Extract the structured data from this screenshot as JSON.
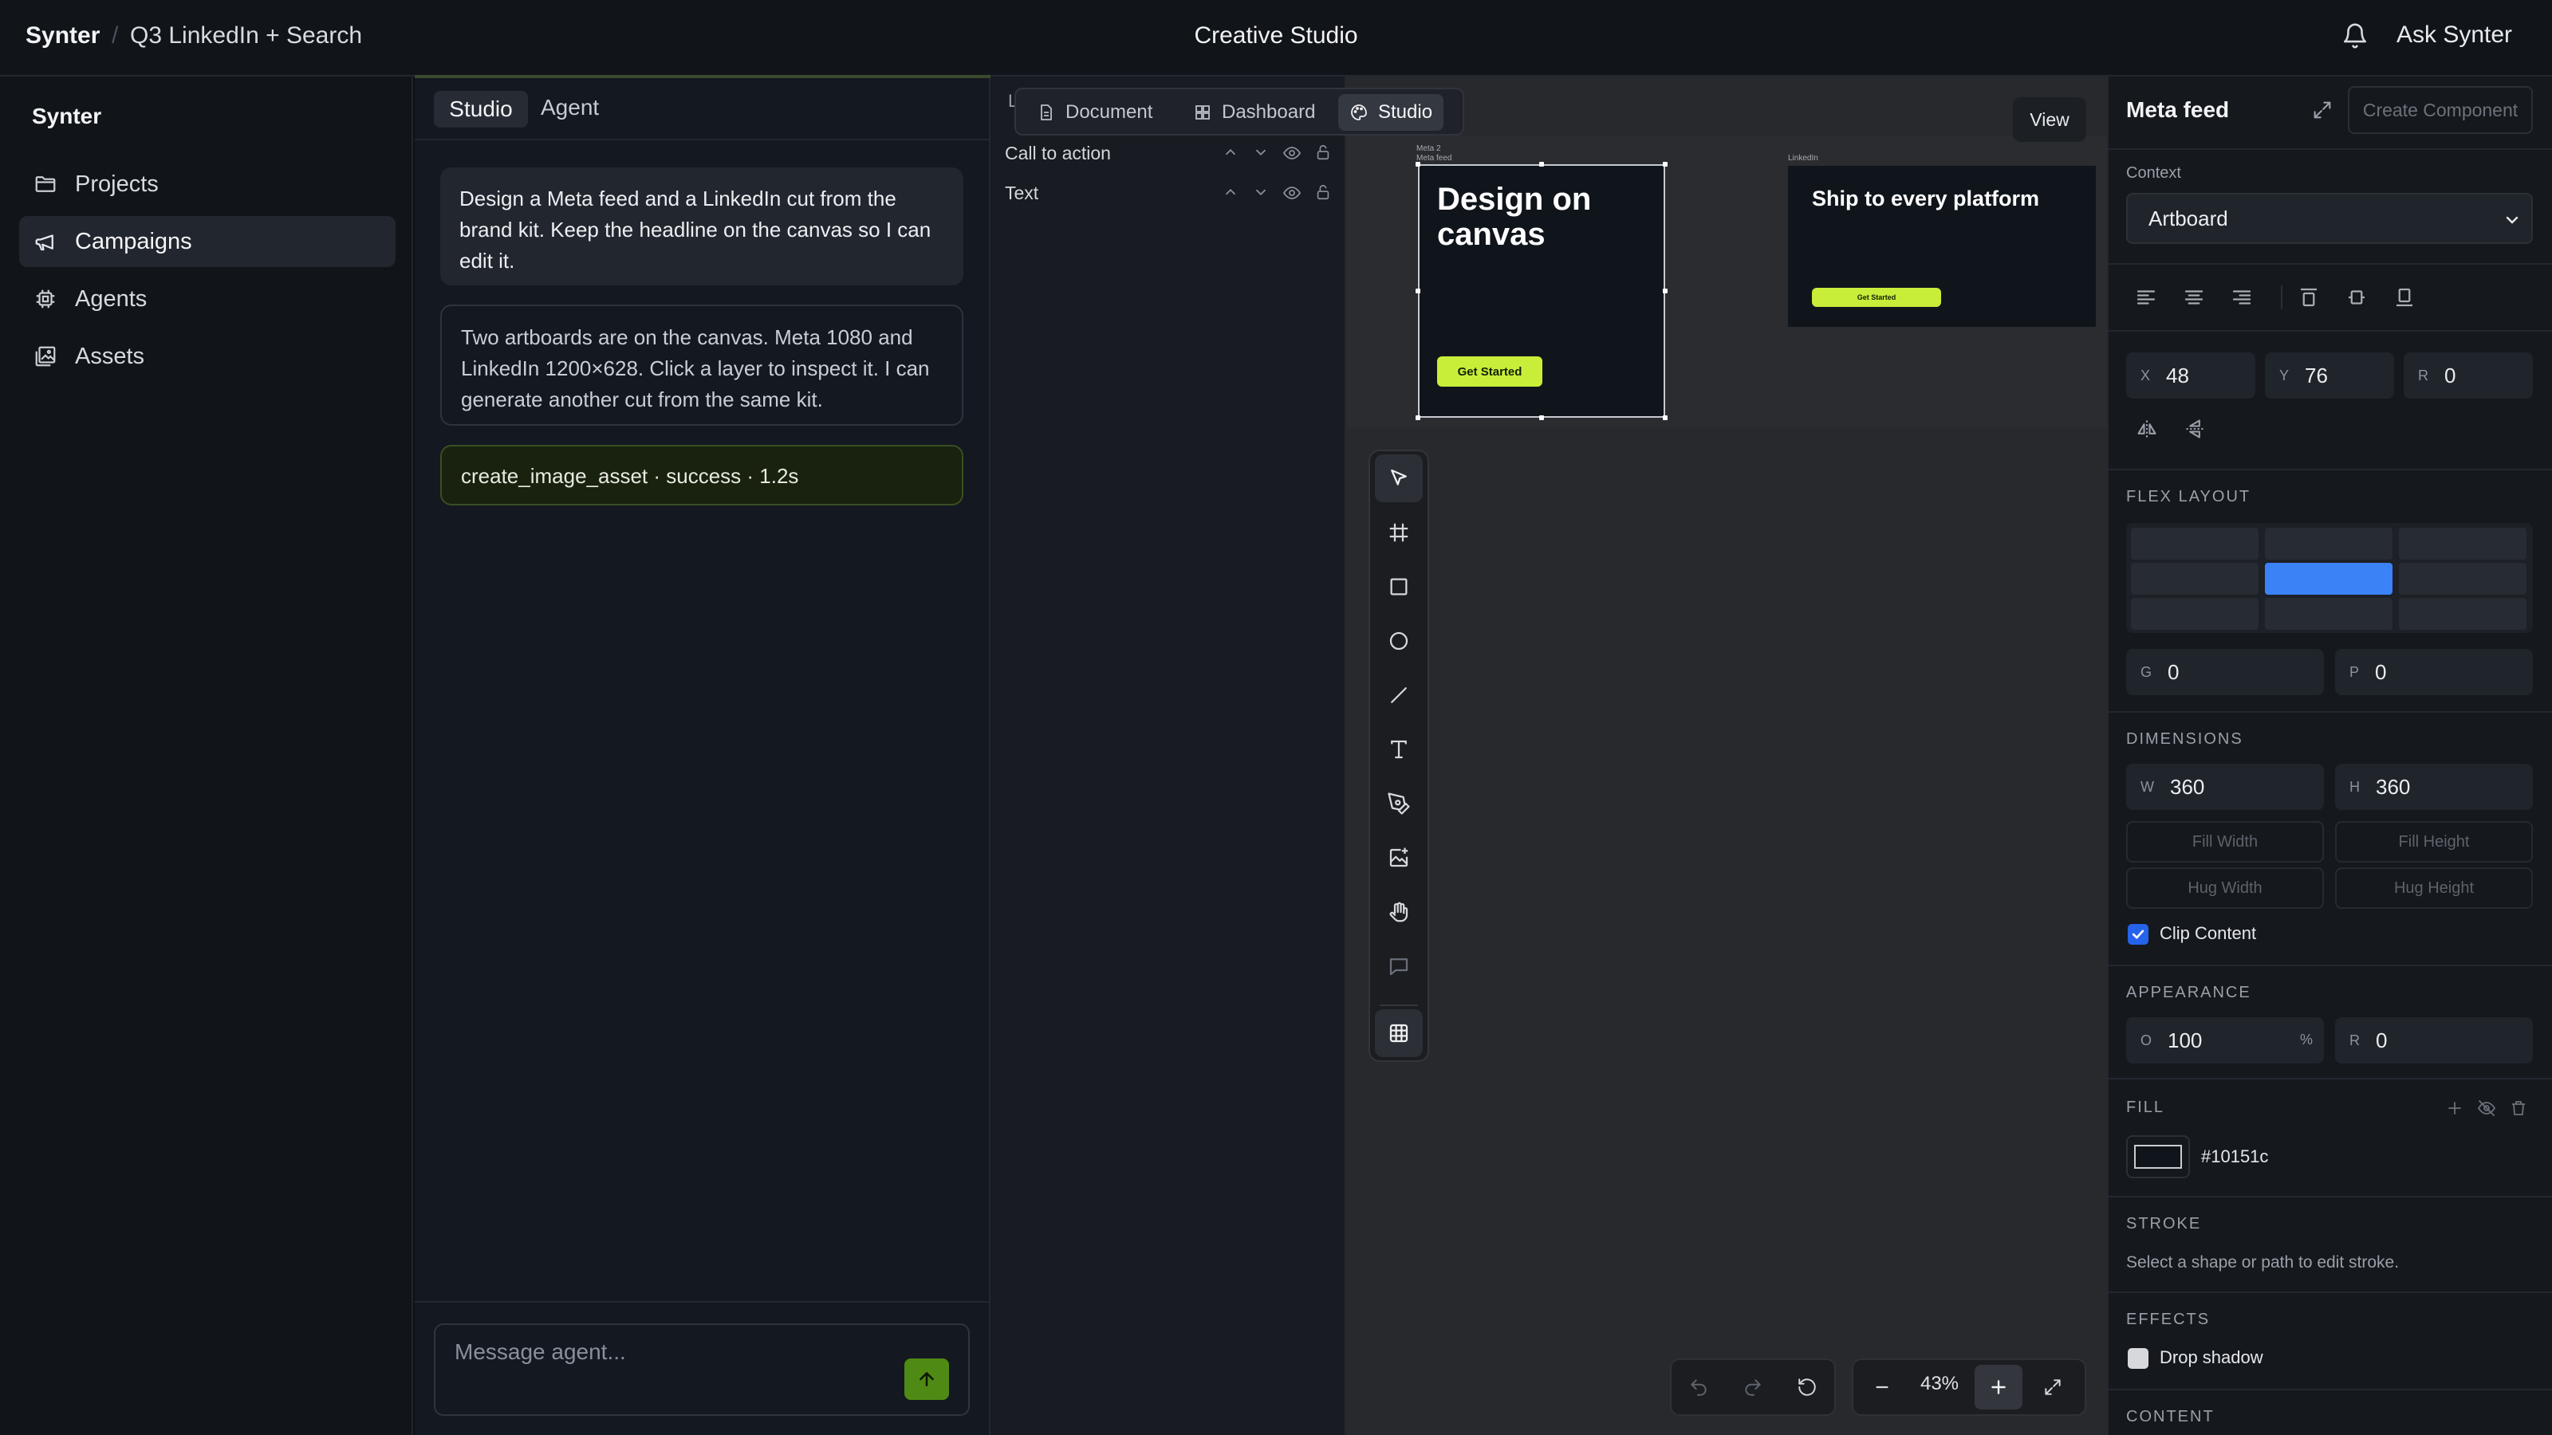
{
  "topbar": {
    "brand": "Synter",
    "breadcrumb": "Q3 LinkedIn + Search",
    "title": "Creative Studio",
    "ask": "Ask Synter"
  },
  "sidebar": {
    "title": "Synter",
    "items": [
      {
        "label": "Projects",
        "icon": "folder-icon"
      },
      {
        "label": "Campaigns",
        "icon": "megaphone-icon",
        "active": true
      },
      {
        "label": "Agents",
        "icon": "cpu-icon"
      },
      {
        "label": "Assets",
        "icon": "images-icon"
      }
    ]
  },
  "chat": {
    "tabs": [
      "Studio",
      "Agent"
    ],
    "messages": [
      "Design a Meta feed and a LinkedIn cut from the brand kit. Keep the headline on the canvas so I can edit it.",
      "Two artboards are on the canvas. Meta 1080 and LinkedIn 1200×628. Click a layer to inspect it. I can generate another cut from the same kit.",
      "create_image_asset · success · 1.2s"
    ],
    "composer_placeholder": "Message agent..."
  },
  "layers": {
    "header_fragment": "L",
    "items": [
      "Call to action",
      "Text"
    ]
  },
  "view_tabs": [
    {
      "label": "Document",
      "icon": "document-icon"
    },
    {
      "label": "Dashboard",
      "icon": "dashboard-icon"
    },
    {
      "label": "Studio",
      "icon": "palette-icon",
      "active": true
    }
  ],
  "canvas": {
    "view_button": "View",
    "artboards": [
      {
        "label": "Meta feed",
        "sublabel": "Meta 2",
        "headline": "Design on canvas",
        "cta": "Get Started"
      },
      {
        "label": "LinkedIn",
        "headline": "Ship to every platform",
        "cta": "Get Started"
      }
    ],
    "zoom": "43%"
  },
  "props": {
    "title": "Meta feed",
    "create_component": "Create Component",
    "context_label": "Context",
    "context_value": "Artboard",
    "position": {
      "x_label": "X",
      "x": "48",
      "y_label": "Y",
      "y": "76",
      "r_label": "R",
      "r": "0"
    },
    "flex_title": "FLEX LAYOUT",
    "gap": {
      "g_label": "G",
      "g": "0",
      "p_label": "P",
      "p": "0"
    },
    "dimensions_title": "DIMENSIONS",
    "dims": {
      "w_label": "W",
      "w": "360",
      "h_label": "H",
      "h": "360"
    },
    "sizing": [
      "Fill Width",
      "Fill Height",
      "Hug Width",
      "Hug Height"
    ],
    "clip_label": "Clip Content",
    "clip_checked": true,
    "appearance_title": "APPEARANCE",
    "appearance": {
      "o_label": "O",
      "o": "100",
      "unit": "%",
      "r_label": "R",
      "r": "0"
    },
    "fill_title": "FILL",
    "fill_hex": "#10151c",
    "stroke_title": "STROKE",
    "stroke_hint": "Select a shape or path to edit stroke.",
    "effects_title": "EFFECTS",
    "shadow_label": "Drop shadow",
    "content_title": "CONTENT"
  },
  "colors": {
    "accent_green": "#c8ee3a",
    "send_green": "#4f8a14",
    "selection_blue": "#3b82f6",
    "artboard_fill": "#10151c"
  }
}
